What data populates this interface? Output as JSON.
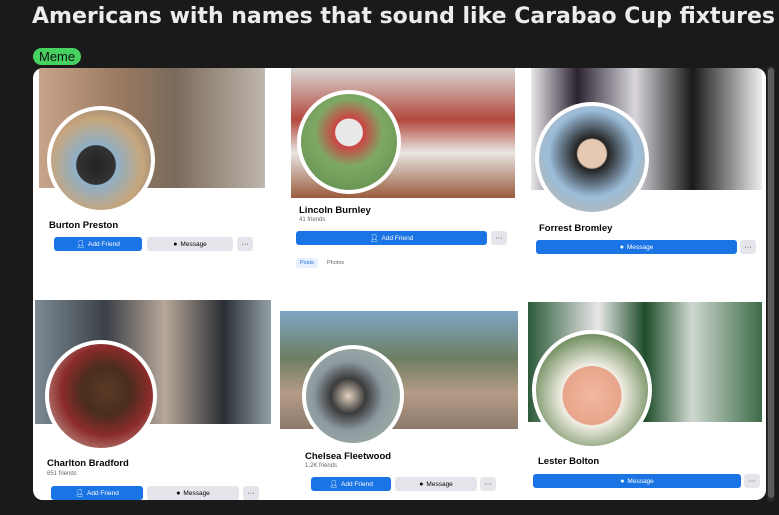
{
  "post": {
    "title": "Americans with names that sound like Carabao Cup fixtures",
    "flair": "Meme"
  },
  "icons": {
    "add_friend": "add-friend-icon",
    "message": "messenger-icon",
    "more": "more-icon"
  },
  "colors": {
    "flair": "#46d160",
    "fb_blue": "#1b74e4",
    "fb_gray": "#e4e6eb",
    "background": "#1a1a1b"
  },
  "profiles": [
    {
      "name": "Burton Preston",
      "friends": "",
      "add_friend": "Add Friend",
      "message": "Message",
      "more": "···"
    },
    {
      "name": "Lincoln Burnley",
      "friends": "41 friends",
      "add_friend": "Add Friend",
      "more": "···",
      "tabs": [
        "Posts",
        "Photos"
      ]
    },
    {
      "name": "Forrest Bromley",
      "friends": "",
      "message": "Message",
      "more": "···"
    },
    {
      "name": "Charlton Bradford",
      "friends": "651 friends",
      "add_friend": "Add Friend",
      "message": "Message",
      "more": "···"
    },
    {
      "name": "Chelsea Fleetwood",
      "friends": "1.2K friends",
      "add_friend": "Add Friend",
      "message": "Message",
      "more": "···"
    },
    {
      "name": "Lester Bolton",
      "friends": "",
      "message": "Message",
      "more": "···"
    }
  ]
}
